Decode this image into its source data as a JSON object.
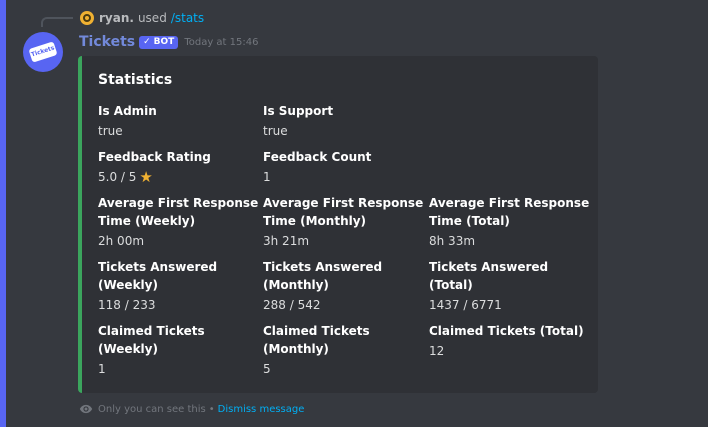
{
  "reply": {
    "username": "ryan.",
    "used": "used",
    "command": "/stats"
  },
  "message": {
    "author": "Tickets",
    "bot_tag": "BOT",
    "timestamp": "Today at 15:46",
    "avatar_text": "Tickets"
  },
  "embed": {
    "title": "Statistics",
    "accent_color": "#3ba55d",
    "fields": {
      "is_admin": {
        "name": "Is Admin",
        "value": "true"
      },
      "is_support": {
        "name": "Is Support",
        "value": "true"
      },
      "feedback_rating": {
        "name": "Feedback Rating",
        "value": "5.0 / 5"
      },
      "feedback_count": {
        "name": "Feedback Count",
        "value": "1"
      },
      "afrt_weekly": {
        "name": "Average First Response Time (Weekly)",
        "value": "2h 00m"
      },
      "afrt_monthly": {
        "name": "Average First Response Time (Monthly)",
        "value": "3h 21m"
      },
      "afrt_total": {
        "name": "Average First Response Time (Total)",
        "value": "8h 33m"
      },
      "answered_weekly": {
        "name": "Tickets Answered (Weekly)",
        "value": "118 / 233"
      },
      "answered_monthly": {
        "name": "Tickets Answered (Monthly)",
        "value": "288 / 542"
      },
      "answered_total": {
        "name": "Tickets Answered (Total)",
        "value": "1437 / 6771"
      },
      "claimed_weekly": {
        "name": "Claimed Tickets (Weekly)",
        "value": "1"
      },
      "claimed_monthly": {
        "name": "Claimed Tickets (Monthly)",
        "value": "5"
      },
      "claimed_total": {
        "name": "Claimed Tickets (Total)",
        "value": "12"
      }
    }
  },
  "footer": {
    "notice": "Only you can see this",
    "separator": "•",
    "dismiss": "Dismiss message"
  },
  "icons": {
    "star": "star-icon",
    "eye": "eye-icon",
    "verified": "check-icon"
  }
}
